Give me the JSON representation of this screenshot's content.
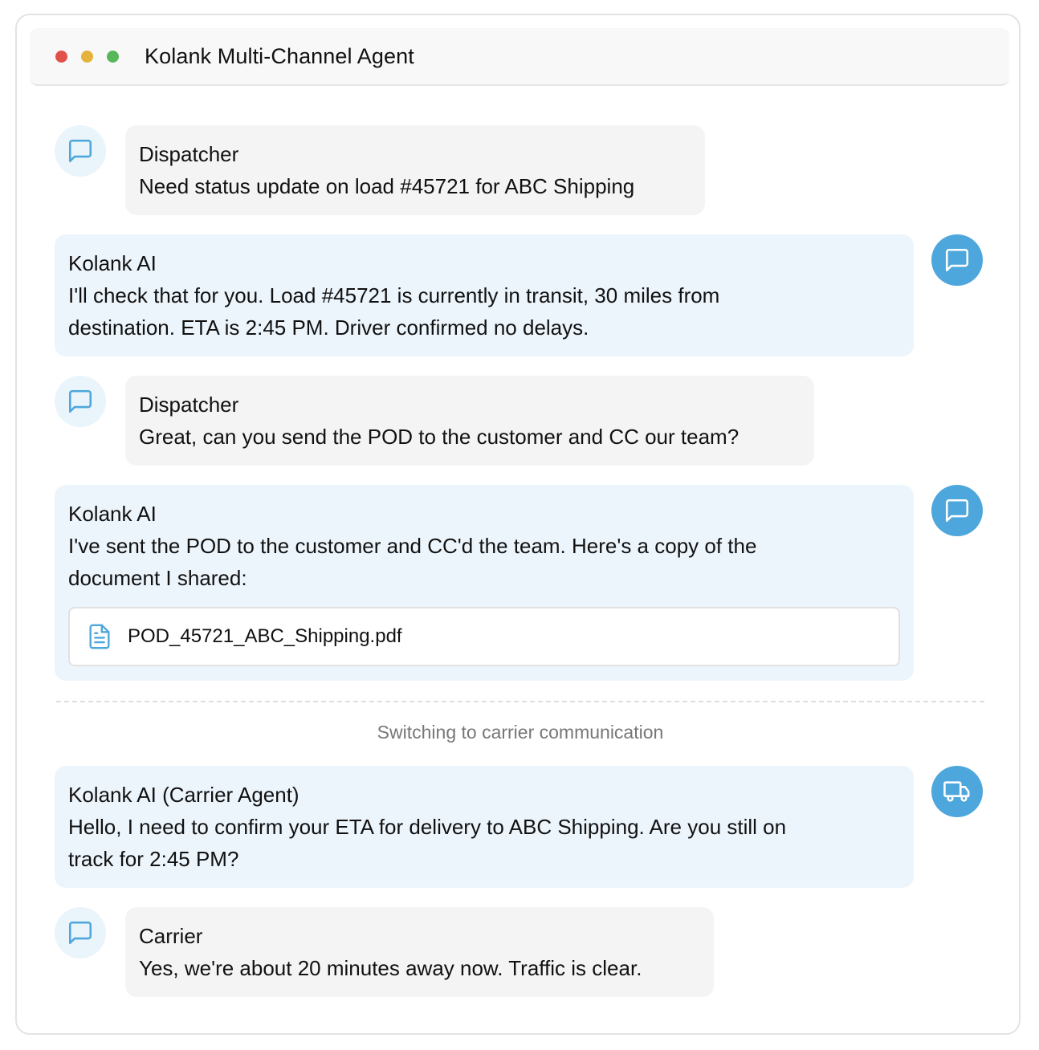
{
  "window": {
    "title": "Kolank Multi-Channel Agent"
  },
  "messages": [
    {
      "sender": "Dispatcher",
      "text": "Need status update on load #45721 for ABC Shipping",
      "avatar_icon": "message-square-icon"
    },
    {
      "sender": "Kolank AI",
      "line1": "I'll check that for you. Load #45721 is currently in transit, 30 miles from",
      "line2": "destination. ETA is 2:45 PM. Driver confirmed no delays.",
      "avatar_icon": "message-square-icon"
    },
    {
      "sender": "Dispatcher",
      "text": "Great, can you send the POD to the customer and CC our team?",
      "avatar_icon": "message-square-icon"
    },
    {
      "sender": "Kolank AI",
      "line1": "I've sent the POD to the customer and CC'd the team. Here's a copy of the",
      "line2": "document I shared:",
      "attachment": {
        "filename": "POD_45721_ABC_Shipping.pdf",
        "icon": "file-text-icon"
      },
      "avatar_icon": "message-square-icon"
    },
    {
      "sender": "Kolank AI (Carrier Agent)",
      "line1": "Hello, I need to confirm your ETA for delivery to ABC Shipping. Are you still on",
      "line2": "track for 2:45 PM?",
      "avatar_icon": "truck-icon"
    },
    {
      "sender": "Carrier",
      "text": "Yes, we're about 20 minutes away now. Traffic is clear.",
      "avatar_icon": "message-square-icon"
    }
  ],
  "divider_note": "Switching to carrier communication",
  "colors": {
    "accent": "#4ea7dc",
    "user_bubble": "#f4f4f4",
    "ai_bubble": "#edf5fc",
    "close": "#e2504a",
    "minimize": "#e5b23b",
    "maximize": "#56b85a"
  }
}
